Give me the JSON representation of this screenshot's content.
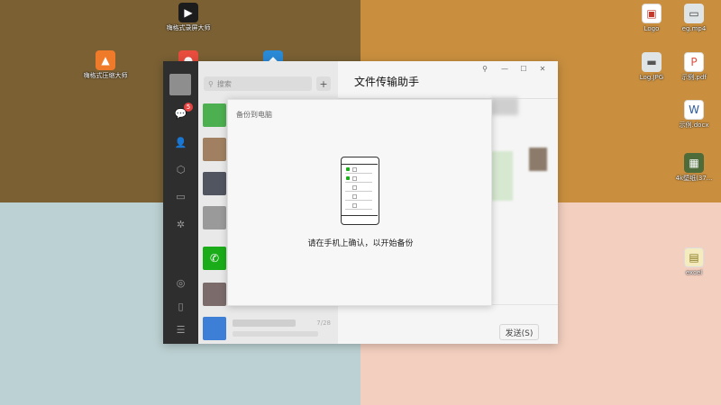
{
  "desktop": {
    "colors": {
      "top_left": "#7a6033",
      "top_right": "#c98f3f",
      "bottom_left": "#bcd1d3",
      "bottom_right": "#f3cfbf"
    },
    "icons": [
      {
        "label": "嗨格式录屏大师",
        "icon": "screen-recorder-icon",
        "color": "#1c1c1c"
      },
      {
        "label": "嗨格式压缩大师",
        "icon": "compressor-icon",
        "color": "#ef7a2a"
      },
      {
        "label": "",
        "icon": "red-app-icon",
        "color": "#e84d3d"
      },
      {
        "label": "",
        "icon": "blue-app-icon",
        "color": "#2a8ad6"
      },
      {
        "label": "Logo",
        "icon": "image-file-icon",
        "color": "#c0392b"
      },
      {
        "label": "eg.mp4",
        "icon": "video-file-icon",
        "color": "#7f8c8d"
      },
      {
        "label": "Log.JPG",
        "icon": "jpg-file-icon",
        "color": "#95a5a6"
      },
      {
        "label": "示例.pdf",
        "icon": "pdf-file-icon",
        "color": "#e74c3c"
      },
      {
        "label": "示例.docx",
        "icon": "word-file-icon",
        "color": "#2b579a"
      },
      {
        "label": "4k壁纸(37...",
        "icon": "image-thumb-icon",
        "color": "#4e6b3a"
      },
      {
        "label": "excel",
        "icon": "excel-file-icon",
        "color": "#c8b43a"
      }
    ]
  },
  "wechat": {
    "search": {
      "placeholder": "搜索",
      "icon": "search-icon"
    },
    "add_button": "+",
    "nav": {
      "chat_badge": "5",
      "icons": [
        "chat-icon",
        "contacts-icon",
        "favorites-icon",
        "files-icon",
        "moments-icon",
        "miniprogram-icon",
        "phone-icon",
        "menu-icon"
      ]
    },
    "chats": [
      {
        "avatar_color": "#4caf50",
        "time": ""
      },
      {
        "avatar_color": "#a08060",
        "time": ""
      },
      {
        "avatar_color": "#505560",
        "time": ""
      },
      {
        "avatar_color": "#9a9a9a",
        "time": ""
      },
      {
        "avatar_color": "#1aad19",
        "time": ""
      },
      {
        "avatar_color": "#7b6b6b",
        "time": ""
      },
      {
        "avatar_color": "#3d7fd6",
        "time": "7/28"
      }
    ],
    "window_title": "文件传输助手",
    "window_controls": [
      "⚲",
      "—",
      "☐",
      "✕"
    ],
    "send_button": "发送(S)"
  },
  "dialog": {
    "title": "备份到电脑",
    "message": "请在手机上确认，以开始备份",
    "icon": "phone-icon"
  }
}
